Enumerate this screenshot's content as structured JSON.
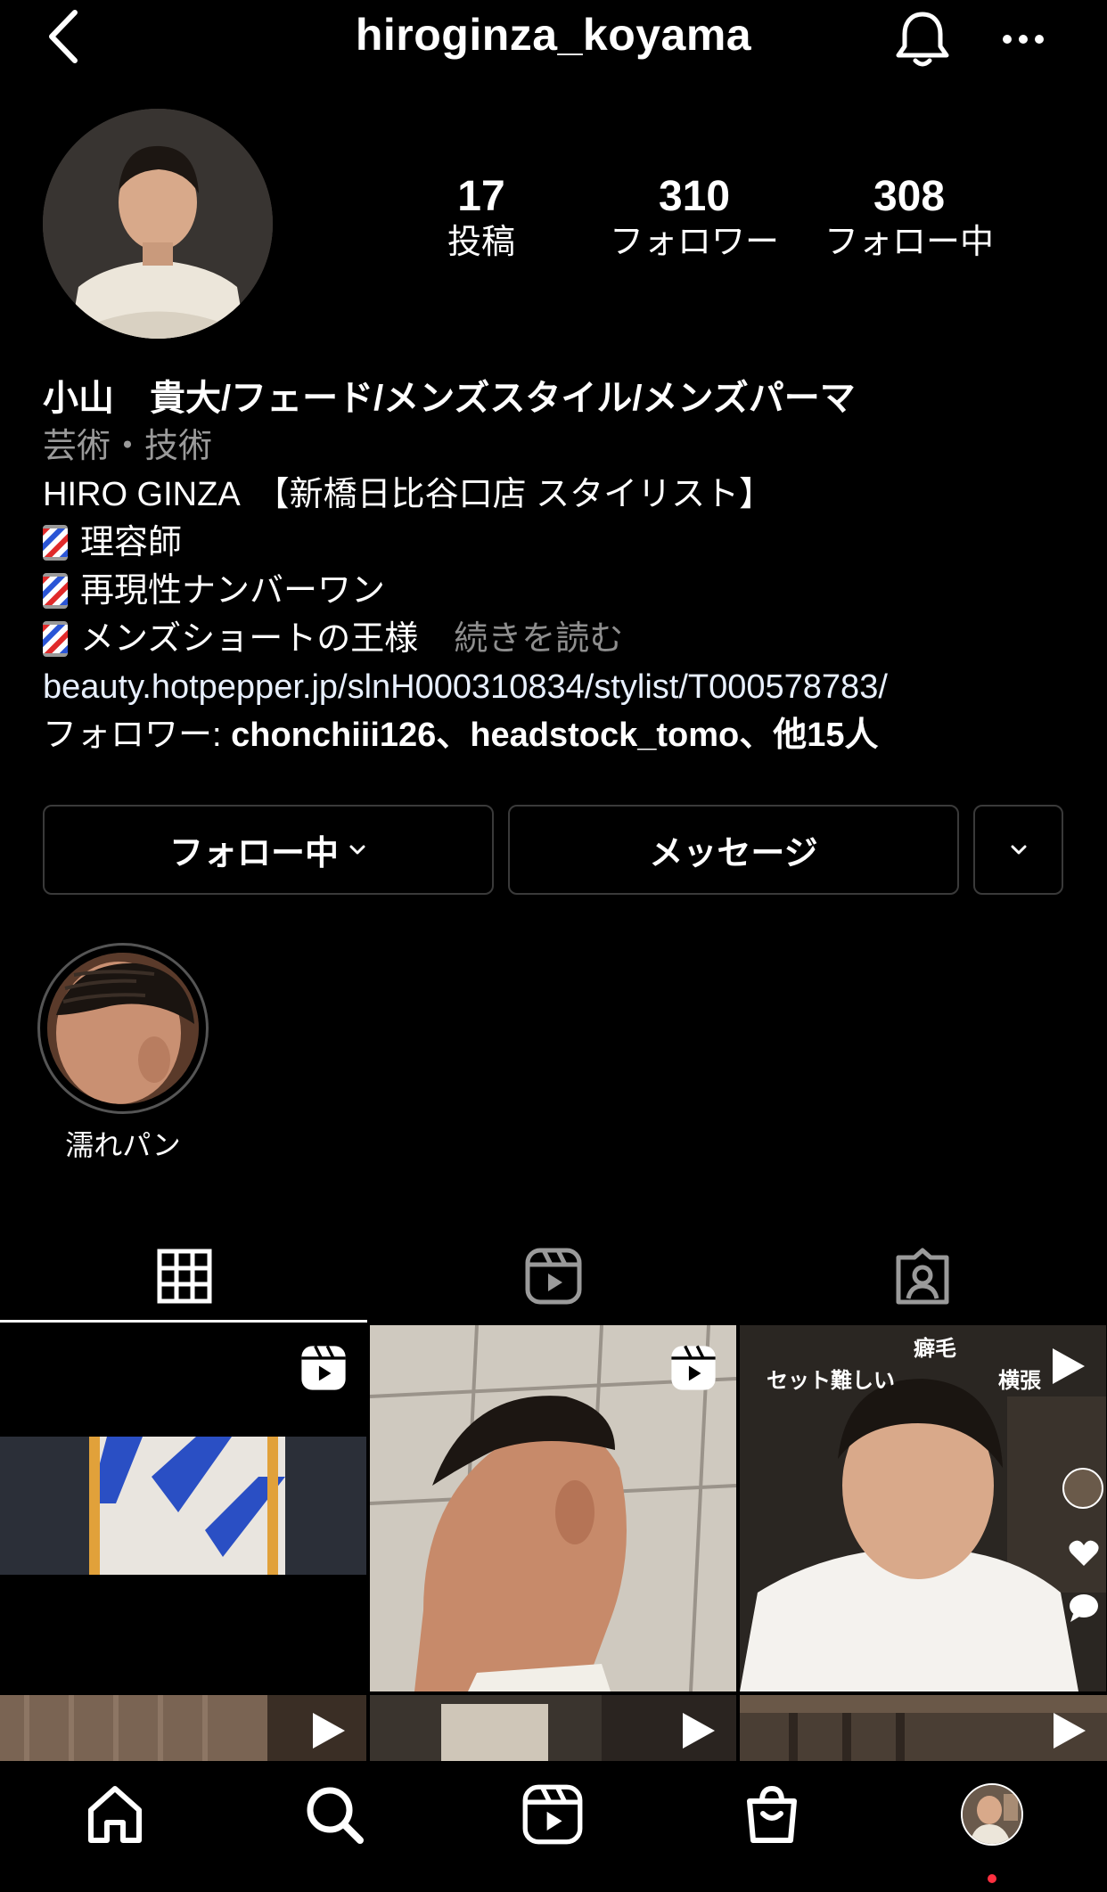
{
  "header": {
    "username": "hiroginza_koyama",
    "back_icon": "chevron-left-icon",
    "notification_icon": "bell-icon",
    "more_icon": "ellipsis-icon"
  },
  "stats": {
    "posts": {
      "value": "17",
      "label": "投稿"
    },
    "followers": {
      "value": "310",
      "label": "フォロワー"
    },
    "following": {
      "value": "308",
      "label": "フォロー中"
    }
  },
  "bio": {
    "name": "小山　貴大/フェード/メンズスタイル/メンズパーマ",
    "category": "芸術・技術",
    "line1": "HIRO GINZA　【新橋日比谷口店 スタイリスト】",
    "line2": "理容師",
    "line3": "再現性ナンバーワン",
    "line4": "メンズショートの王様",
    "more": "続きを読む",
    "link": "beauty.hotpepper.jp/slnH000310834/stylist/T000578783/",
    "followed_by_prefix": "フォロワー: ",
    "followed_by_names": "chonchiii126、headstock_tomo、他15人"
  },
  "buttons": {
    "following": "フォロー中",
    "message": "メッセージ"
  },
  "highlight": {
    "label": "濡れパン"
  },
  "grid": {
    "cell3_texts": {
      "top": "癖毛",
      "left": "セット難しい",
      "right": "横張"
    }
  },
  "colors": {
    "background": "#000000",
    "text": "#ffffff",
    "muted": "#9a9a9a",
    "border": "#3a3a3a",
    "notification_dot": "#ff3040"
  }
}
